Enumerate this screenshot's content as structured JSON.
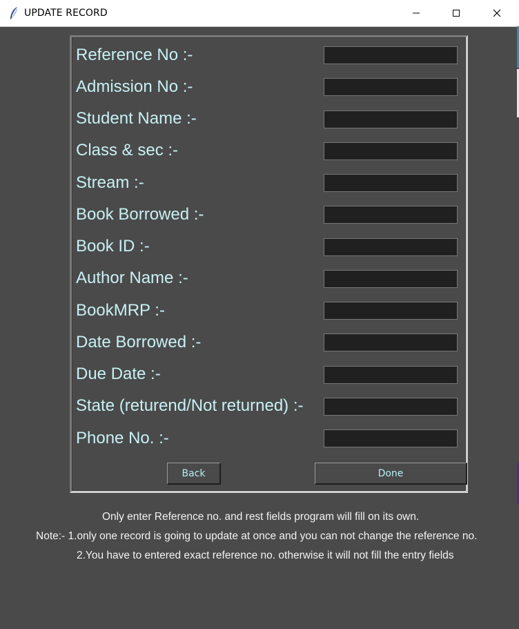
{
  "window": {
    "title": "UPDATE RECORD",
    "app_icon": "feather-icon",
    "controls": [
      "minimize-icon",
      "maximize-icon",
      "close-icon"
    ]
  },
  "form": {
    "fields": [
      {
        "label": "Reference No :-",
        "value": ""
      },
      {
        "label": "Admission No :-",
        "value": ""
      },
      {
        "label": "Student Name :-",
        "value": ""
      },
      {
        "label": "Class & sec :-",
        "value": ""
      },
      {
        "label": "Stream :-",
        "value": ""
      },
      {
        "label": "Book Borrowed :-",
        "value": ""
      },
      {
        "label": "Book ID :-",
        "value": ""
      },
      {
        "label": "Author Name :-",
        "value": ""
      },
      {
        "label": "BookMRP :-",
        "value": ""
      },
      {
        "label": "Date Borrowed :-",
        "value": ""
      },
      {
        "label": "Due Date :-",
        "value": ""
      },
      {
        "label": "State (returend/Not returned) :-",
        "value": ""
      },
      {
        "label": "Phone No. :-",
        "value": ""
      }
    ],
    "back_label": "Back",
    "done_label": "Done"
  },
  "notes": {
    "line1": "Only enter Reference no. and rest fields program will fill on its own.",
    "line2": "Note:- 1.only one record is going to update at once and you can not change the reference no.",
    "line3": "2.You have to entered exact reference no. otherwise it will not fill the entry fields"
  },
  "colors": {
    "background": "#4a4a4a",
    "label_text": "#c8f0f4",
    "entry_background": "#202020",
    "button_text": "#b6eef2",
    "note_text": "#f2f2f2"
  }
}
